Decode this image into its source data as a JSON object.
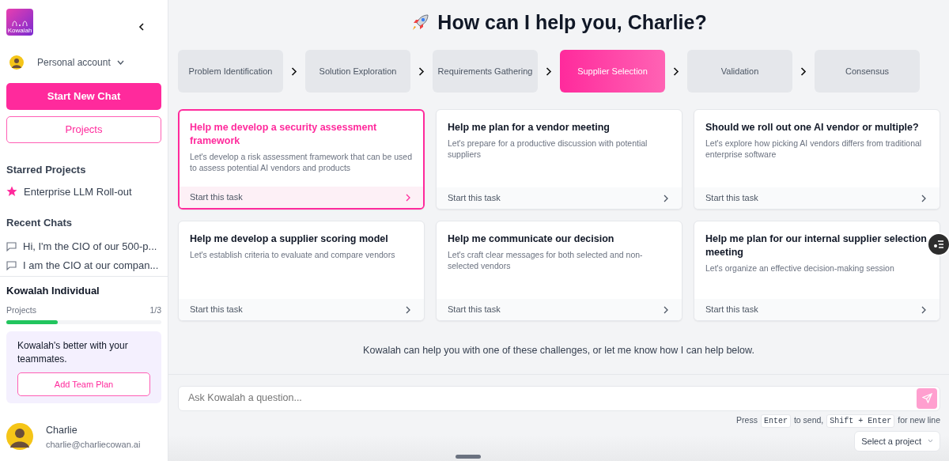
{
  "logo": {
    "text": "Kowalah"
  },
  "sidebar": {
    "account": "Personal account",
    "new_chat_button": "Start New Chat",
    "projects_button": "Projects",
    "starred_heading": "Starred Projects",
    "starred": [
      {
        "label": "Enterprise LLM Roll-out"
      }
    ],
    "recent_heading": "Recent Chats",
    "recent": [
      {
        "label": "Hi, I'm the CIO of our 500-p..."
      },
      {
        "label": "I am the CIO at our compan..."
      }
    ],
    "plan": {
      "name": "Kowalah Individual",
      "meter_label": "Projects",
      "meter_reading": "1/3",
      "level": 0.33
    },
    "promo": {
      "text": "Kowalah's better with your teammates.",
      "button": "Add Team Plan"
    },
    "user": {
      "name": "Charlie",
      "email": "charlie@charliecowan.ai"
    }
  },
  "heading": "How can I help you, Charlie?",
  "stages": [
    {
      "label": "Problem Identification",
      "selected": false
    },
    {
      "label": "Solution Exploration",
      "selected": false
    },
    {
      "label": "Requirements Gathering",
      "selected": false
    },
    {
      "label": "Supplier Selection",
      "selected": true
    },
    {
      "label": "Validation",
      "selected": false
    },
    {
      "label": "Consensus",
      "selected": false
    }
  ],
  "tasks": [
    {
      "title": "Help me develop a security assessment framework",
      "description": "Let's develop a risk assessment framework that can be used to assess potential AI vendors and products",
      "action": "Start this task",
      "selected": true
    },
    {
      "title": "Help me plan for a vendor meeting",
      "description": "Let's prepare for a productive discussion with potential suppliers",
      "action": "Start this task",
      "selected": false
    },
    {
      "title": "Should we roll out one AI vendor or multiple?",
      "description": "Let's explore how picking AI vendors differs from traditional enterprise software",
      "action": "Start this task",
      "selected": false
    },
    {
      "title": "Help me develop a supplier scoring model",
      "description": "Let's establish criteria to evaluate and compare vendors",
      "action": "Start this task",
      "selected": false
    },
    {
      "title": "Help me communicate our decision",
      "description": "Let's craft clear messages for both selected and non-selected vendors",
      "action": "Start this task",
      "selected": false
    },
    {
      "title": "Help me plan for our internal supplier selection meeting",
      "description": "Let's organize an effective decision-making session",
      "action": "Start this task",
      "selected": false
    }
  ],
  "hint": "Kowalah can help you with one of these challenges, or let me know how I can help below.",
  "composer": {
    "placeholder": "Ask Kowalah a question...",
    "help": [
      {
        "kind": "text",
        "text": "Press"
      },
      {
        "kind": "key",
        "text": "Enter"
      },
      {
        "kind": "text",
        "text": "to send,"
      },
      {
        "kind": "key",
        "text": "Shift + Enter"
      },
      {
        "kind": "text",
        "text": "for new line"
      }
    ]
  },
  "project_select": "Select a project"
}
